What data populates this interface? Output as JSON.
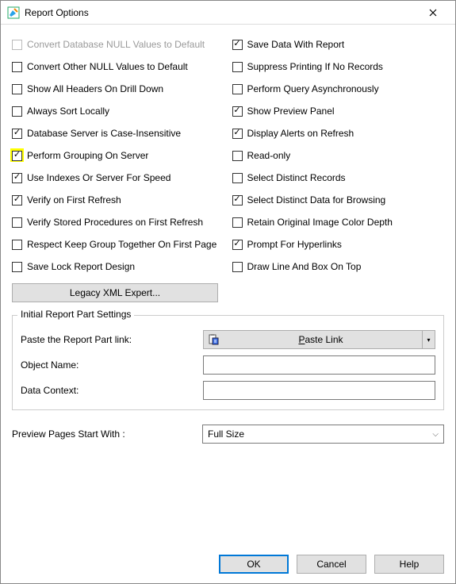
{
  "window": {
    "title": "Report Options"
  },
  "options": {
    "left": [
      {
        "label": "Convert Database NULL Values to Default",
        "checked": false,
        "disabled": true,
        "highlight": false
      },
      {
        "label": "Convert Other NULL Values to Default",
        "checked": false,
        "disabled": false,
        "highlight": false
      },
      {
        "label": "Show All Headers On Drill Down",
        "checked": false,
        "disabled": false,
        "highlight": false
      },
      {
        "label": "Always Sort Locally",
        "checked": false,
        "disabled": false,
        "highlight": false
      },
      {
        "label": "Database Server is Case-Insensitive",
        "checked": true,
        "disabled": false,
        "highlight": false
      },
      {
        "label": "Perform Grouping On Server",
        "checked": true,
        "disabled": false,
        "highlight": true
      },
      {
        "label": "Use Indexes Or Server For Speed",
        "checked": true,
        "disabled": false,
        "highlight": false
      },
      {
        "label": "Verify on First Refresh",
        "checked": true,
        "disabled": false,
        "highlight": false
      },
      {
        "label": "Verify Stored Procedures on First Refresh",
        "checked": false,
        "disabled": false,
        "highlight": false
      },
      {
        "label": "Respect Keep Group Together On First Page",
        "checked": false,
        "disabled": false,
        "highlight": false
      },
      {
        "label": "Save Lock Report Design",
        "checked": false,
        "disabled": false,
        "highlight": false
      }
    ],
    "right": [
      {
        "label": "Save Data With Report",
        "checked": true,
        "disabled": false,
        "highlight": false
      },
      {
        "label": "Suppress Printing If No Records",
        "checked": false,
        "disabled": false,
        "highlight": false
      },
      {
        "label": "Perform Query Asynchronously",
        "checked": false,
        "disabled": false,
        "highlight": false
      },
      {
        "label": "Show Preview Panel",
        "checked": true,
        "disabled": false,
        "highlight": false
      },
      {
        "label": "Display Alerts on Refresh",
        "checked": true,
        "disabled": false,
        "highlight": false
      },
      {
        "label": "Read-only",
        "checked": false,
        "disabled": false,
        "highlight": false
      },
      {
        "label": "Select Distinct Records",
        "checked": false,
        "disabled": false,
        "highlight": false
      },
      {
        "label": "Select Distinct Data for Browsing",
        "checked": true,
        "disabled": false,
        "highlight": false
      },
      {
        "label": "Retain Original Image Color Depth",
        "checked": false,
        "disabled": false,
        "highlight": false
      },
      {
        "label": "Prompt For Hyperlinks",
        "checked": true,
        "disabled": false,
        "highlight": false
      },
      {
        "label": "Draw Line And Box On Top",
        "checked": false,
        "disabled": false,
        "highlight": false
      }
    ]
  },
  "legacy_xml": "Legacy XML Expert...",
  "fieldset": {
    "legend": "Initial Report Part Settings",
    "paste_label": "Paste the Report Part link:",
    "paste_button": "Paste Link",
    "object_name_label": "Object Name:",
    "object_name_value": "",
    "data_context_label": "Data Context:",
    "data_context_value": ""
  },
  "preview": {
    "label": "Preview Pages Start With :",
    "selected": "Full Size"
  },
  "buttons": {
    "ok": "OK",
    "cancel": "Cancel",
    "help": "Help"
  }
}
